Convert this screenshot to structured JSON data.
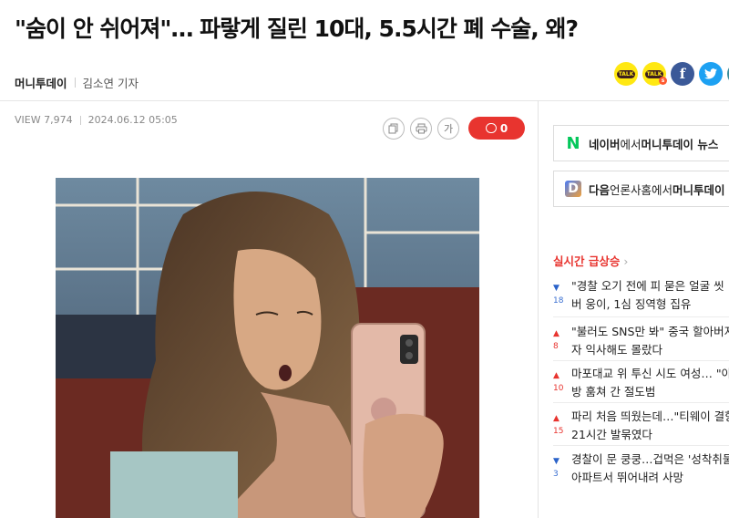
{
  "article": {
    "headline": "\"숨이 안 쉬어져\"… 파랗게 질린 10대, 5.5시간 폐 수술, 왜?",
    "press": "머니투데이",
    "reporter": "김소연 기자",
    "views": "VIEW 7,974",
    "date": "2024.06.12 05:05"
  },
  "share": {
    "kakao_talk_label": "TALK",
    "kakao_story_label": "TALK",
    "kakao_story_badge": "s",
    "facebook_label": "f",
    "twitter_label": "t"
  },
  "tools": {
    "copy_icon": "copy-icon",
    "print_icon": "print-icon",
    "font_size_label": "가",
    "comment_count": "0"
  },
  "sidebar": {
    "naver_banner": {
      "logo": "N",
      "bold": "네이버",
      "mid": "에서 ",
      "bold2": "머니투데이 뉴스"
    },
    "daum_banner": {
      "logo": "D",
      "bold": "다음",
      "mid": "언론사홈에서 ",
      "bold2": "머니투데이"
    },
    "trending_title": "실시간 급상승",
    "trending_chevron": "›",
    "trending": [
      {
        "direction": "down",
        "change": "18",
        "line1": "\"경찰 오기 전에 피 묻은 얼굴 씻",
        "line2": "버 웅이, 1심 징역형 집유"
      },
      {
        "direction": "up",
        "change": "8",
        "line1": "\"불러도 SNS만 봐\" 중국 할아버지",
        "line2": "자 익사해도 몰랐다"
      },
      {
        "direction": "up",
        "change": "10",
        "line1": "마포대교 위 투신 시도 여성… \"아",
        "line2": "방 훔쳐 간 절도범"
      },
      {
        "direction": "up",
        "change": "15",
        "line1": "파리 처음 띄웠는데…\"티웨이 결항",
        "line2": "21시간 발묶였다"
      },
      {
        "direction": "down",
        "change": "3",
        "line1": "경찰이 문 쿵쿵…겁먹은 '성착취물",
        "line2": "아파트서 뛰어내려 사망"
      }
    ]
  },
  "colors": {
    "accent_red": "#e8342f",
    "naver_green": "#03c75a",
    "facebook_blue": "#3b5998",
    "twitter_blue": "#1da1f2",
    "kakao_yellow": "#ffe812"
  }
}
